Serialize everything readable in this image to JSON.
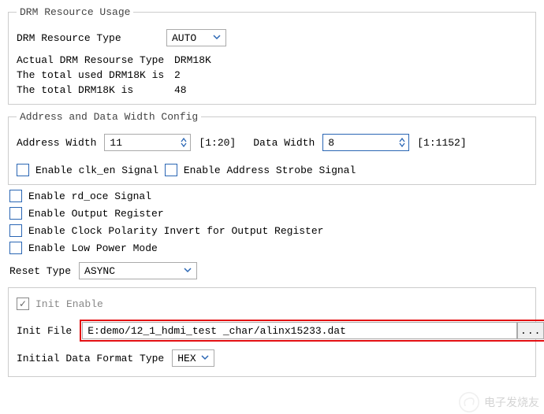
{
  "drm": {
    "legend": "DRM Resource Usage",
    "type_label": "DRM Resource Type",
    "type_value": "AUTO",
    "actual_label": "Actual DRM Resourse Type",
    "actual_value": "DRM18K",
    "used_label": "The total used DRM18K is",
    "used_value": "2",
    "total_label": "The total DRM18K is",
    "total_value": "48"
  },
  "addr": {
    "legend": "Address and Data Width Config",
    "addr_label": "Address Width",
    "addr_value": "11",
    "addr_range": "[1:20]",
    "data_label": "Data Width",
    "data_value": "8",
    "data_range": "[1:1152]",
    "clk_en_label": "Enable clk_en Signal",
    "strobe_label": "Enable Address Strobe Signal"
  },
  "opts": {
    "rd_oce": "Enable rd_oce Signal",
    "out_reg": "Enable Output Register",
    "clk_pol": "Enable Clock Polarity Invert for Output Register",
    "low_power": "Enable Low Power Mode"
  },
  "reset": {
    "label": "Reset Type",
    "value": "ASYNC"
  },
  "init": {
    "enable_label": "Init Enable",
    "file_label": "Init File",
    "file_value": "E:demo/12_1_hdmi_test _char/alinx15233.dat",
    "browse": "...",
    "format_label": "Initial Data Format Type",
    "format_value": "HEX"
  },
  "watermark": "电子发烧友"
}
